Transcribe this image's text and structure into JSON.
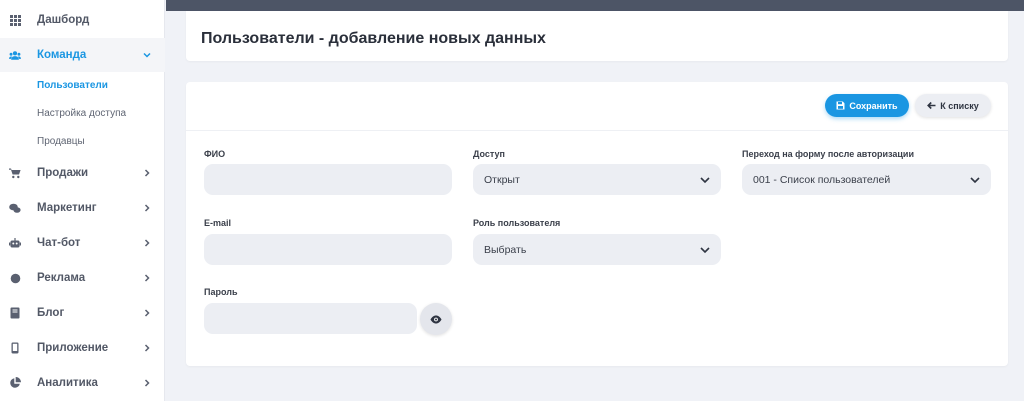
{
  "sidebar": {
    "items": [
      {
        "label": "Дашборд",
        "icon": "grid-icon"
      },
      {
        "label": "Команда",
        "icon": "users-icon"
      },
      {
        "label": "Продажи",
        "icon": "cart-icon"
      },
      {
        "label": "Маркетинг",
        "icon": "chat-bubbles-icon"
      },
      {
        "label": "Чат-бот",
        "icon": "robot-icon"
      },
      {
        "label": "Реклама",
        "icon": "circle-icon"
      },
      {
        "label": "Блог",
        "icon": "book-icon"
      },
      {
        "label": "Приложение",
        "icon": "mobile-icon"
      },
      {
        "label": "Аналитика",
        "icon": "pie-chart-icon"
      }
    ],
    "subitems": [
      {
        "label": "Пользователи"
      },
      {
        "label": "Настройка доступа"
      },
      {
        "label": "Продавцы"
      }
    ]
  },
  "page": {
    "title": "Пользователи - добавление новых данных"
  },
  "toolbar": {
    "save_label": "Сохранить",
    "back_label": "К списку"
  },
  "form": {
    "fio": {
      "label": "ФИО",
      "value": ""
    },
    "email": {
      "label": "E-mail",
      "value": ""
    },
    "password": {
      "label": "Пароль",
      "value": ""
    },
    "access": {
      "label": "Доступ",
      "value": "Открыт"
    },
    "role": {
      "label": "Роль пользователя",
      "value": "Выбрать"
    },
    "redirect": {
      "label": "Переход на форму после авторизации",
      "value": "001 - Список пользователей"
    }
  },
  "colors": {
    "accent": "#1a96e2",
    "topbar": "#4d5566",
    "field_bg": "#eceef3"
  }
}
